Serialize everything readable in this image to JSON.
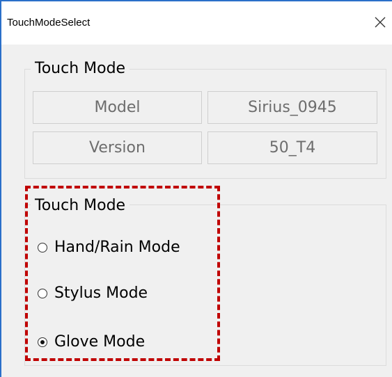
{
  "window": {
    "title": "TouchModeSelect"
  },
  "info_group": {
    "legend": "Touch Mode",
    "rows": [
      {
        "label": "Model",
        "value": "Sirius_0945"
      },
      {
        "label": "Version",
        "value": "50_T4"
      }
    ]
  },
  "mode_group": {
    "legend": "Touch Mode",
    "options": [
      {
        "label": "Hand/Rain Mode",
        "selected": false
      },
      {
        "label": "Stylus Mode",
        "selected": false
      },
      {
        "label": "Glove Mode",
        "selected": true
      }
    ]
  },
  "colors": {
    "highlight": "#c00000",
    "window_border": "#2a6fc9"
  },
  "icons": {
    "close": "close-icon"
  }
}
